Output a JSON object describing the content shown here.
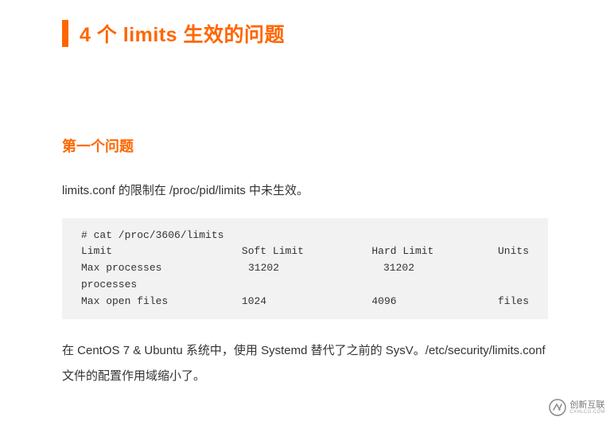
{
  "title": "4 个 limits 生效的问题",
  "subheading": "第一个问题",
  "intro": "limits.conf 的限制在 /proc/pid/limits 中未生效。",
  "outro": "在 CentOS 7 & Ubuntu 系统中，使用 Systemd 替代了之前的 SysV。/etc/security/limits.conf 文件的配置作用域缩小了。",
  "code": {
    "cmd": "# cat /proc/3606/limits",
    "header": {
      "c1": "Limit",
      "c2": "Soft Limit",
      "c3": "Hard Limit",
      "c4": "Units"
    },
    "rows": [
      {
        "c1": "Max processes",
        "c2": "31202",
        "c3": "31202",
        "c4": "processes",
        "wrap": true
      },
      {
        "c1": "Max open files",
        "c2": "1024",
        "c3": "4096",
        "c4": "files",
        "wrap": false
      }
    ]
  },
  "watermark": {
    "brand": "创新互联",
    "sub": "CXHLCG.COM"
  }
}
